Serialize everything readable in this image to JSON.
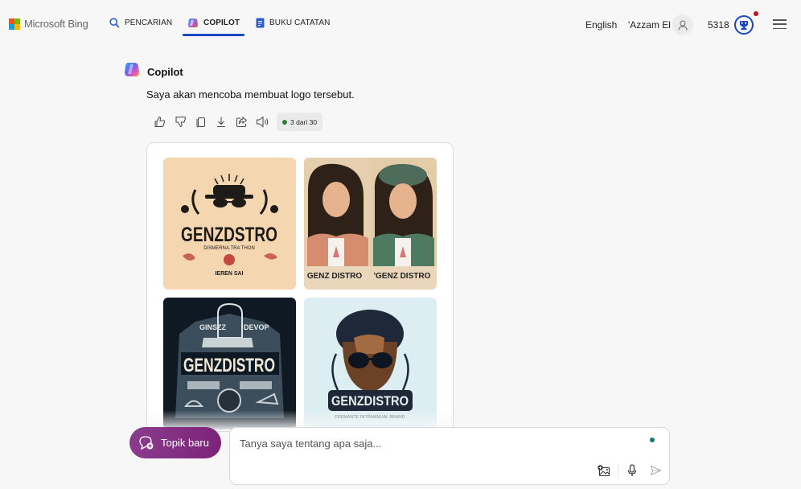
{
  "header": {
    "brand": "Microsoft Bing",
    "tabs": [
      {
        "label": "PENCARIAN",
        "icon": "search-icon",
        "active": false
      },
      {
        "label": "COPILOT",
        "icon": "copilot-icon",
        "active": true
      },
      {
        "label": "BUKU CATATAN",
        "icon": "notebook-icon",
        "active": false
      }
    ],
    "language": "English",
    "username": "'Azzam El",
    "points": "5318",
    "accent_color": "#1a47c9"
  },
  "chat": {
    "sender": "Copilot",
    "message": "Saya akan mencoba membuat logo tersebut.",
    "actions": [
      "like",
      "dislike",
      "copy",
      "download",
      "share",
      "read-aloud"
    ],
    "counter": "3 dari 30",
    "images": [
      {
        "alt": "GENZ DSTRO logo with bucket hat and sunglasses",
        "text": "GENZDSTRO",
        "subtext": "DISMERNA.TRA THON",
        "bottom": "IEREN SAI"
      },
      {
        "alt": "GENZ DISTRO two illustrated women",
        "left_caption": "GENZ DISTRO",
        "right_caption": "'GENZ DISTRO"
      },
      {
        "alt": "GENZDISTRO sneaker emblem dark",
        "text": "GENZDISTRO",
        "top_left": "GINSZZ",
        "top_right": "DEVOP"
      },
      {
        "alt": "GENZDISTRO man with sunglasses",
        "text": "GENZDISTRO",
        "subtext": "FREMANTE INTRNANUAL BRAND"
      }
    ]
  },
  "composer": {
    "new_topic_label": "Topik baru",
    "placeholder": "Tanya saya tentang apa saja...",
    "value": "",
    "new_topic_color": "#86338a"
  }
}
